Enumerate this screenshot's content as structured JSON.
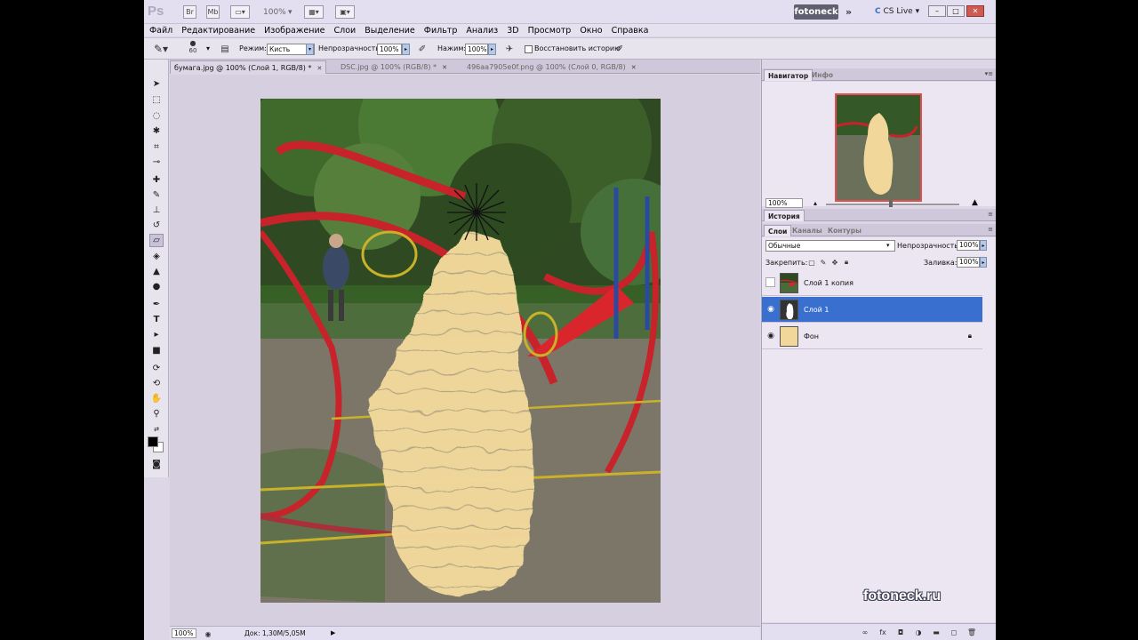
{
  "titlebar": {
    "logo": "Ps",
    "icons": [
      "bridge-icon",
      "minibridge-icon",
      "view-icon",
      "zoom-icon",
      "arrange-icon",
      "screen-mode-icon"
    ],
    "zoom_value": "100%",
    "workspace": "fotoneck",
    "more": "»",
    "cs_live": "CS Live",
    "window_buttons": [
      "–",
      "□",
      "✕"
    ]
  },
  "menu": [
    "Файл",
    "Редактирование",
    "Изображение",
    "Слои",
    "Выделение",
    "Фильтр",
    "Анализ",
    "3D",
    "Просмотр",
    "Окно",
    "Справка"
  ],
  "options": {
    "brush_size": "60",
    "mode_label": "Режим:",
    "mode_value": "Кисть",
    "opacity_label": "Непрозрачность:",
    "opacity_value": "100%",
    "pressure_label": "Нажим:",
    "pressure_value": "100%",
    "history_label": "Восстановить историю"
  },
  "tabs": [
    {
      "label": "бумага.jpg @ 100% (Слой 1, RGB/8) *",
      "active": true
    },
    {
      "label": "DSC.jpg @ 100% (RGB/8) *",
      "active": false
    },
    {
      "label": "496aa7905e0f.png @ 100% (Слой 0, RGB/8)",
      "active": false
    }
  ],
  "status": {
    "zoom": "100%",
    "doc": "Док: 1,30M/5,05M"
  },
  "navigator": {
    "tabs": [
      "Навигатор",
      "Инфо"
    ],
    "zoom": "100%"
  },
  "history_panel": {
    "tab": "История"
  },
  "layers_panel": {
    "tabs": [
      "Слои",
      "Каналы",
      "Контуры"
    ],
    "blend_mode": "Обычные",
    "opacity_label": "Непрозрачность:",
    "opacity_value": "100%",
    "lock_label": "Закрепить:",
    "fill_label": "Заливка:",
    "fill_value": "100%",
    "layers": [
      {
        "name": "Слой 1 копия",
        "visible": false,
        "selected": false,
        "locked": false
      },
      {
        "name": "Слой 1",
        "visible": true,
        "selected": true,
        "locked": false
      },
      {
        "name": "Фон",
        "visible": true,
        "selected": false,
        "locked": true
      }
    ]
  },
  "watermark": "fotoneck.ru",
  "colors": {
    "selection": "#3970d0",
    "paper": "#f1d79a",
    "playground_red": "#c8222a"
  }
}
